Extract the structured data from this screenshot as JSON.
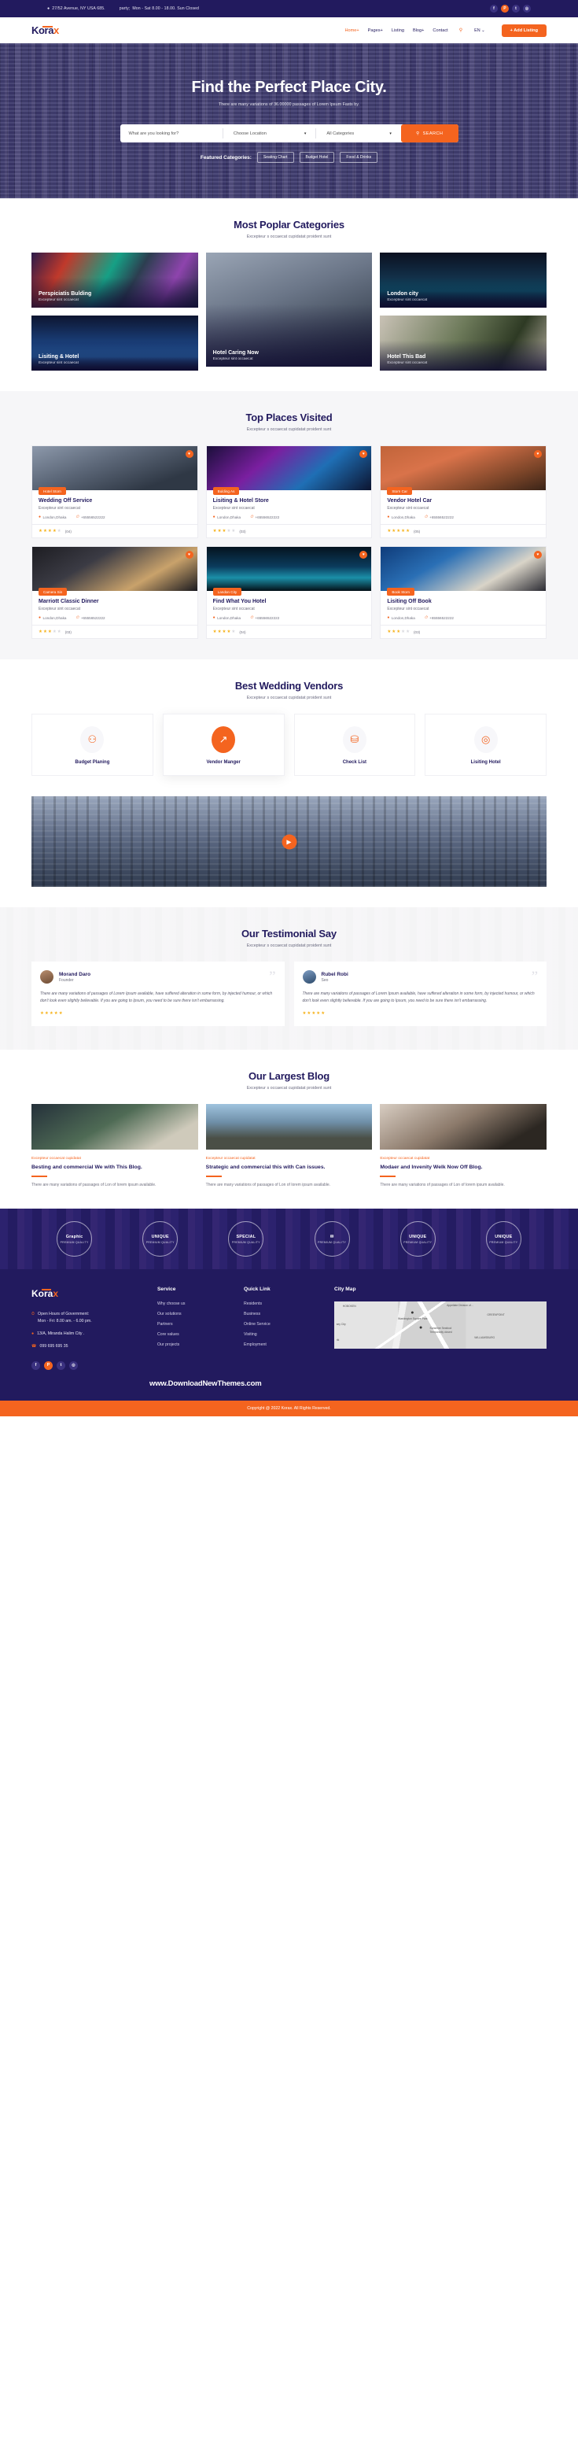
{
  "topbar": {
    "address": "27/52 Avenue, NY USA 685.",
    "hours": "Mon - Sat 8.00 - 18.00. Sun Closed",
    "pin_icon": "location-pin-icon",
    "clock_icon": "clock-icon",
    "socials": [
      {
        "name": "facebook-icon",
        "glyph": "f"
      },
      {
        "name": "pinterest-icon",
        "glyph": "P"
      },
      {
        "name": "twitter-icon",
        "glyph": "t"
      },
      {
        "name": "instagram-icon",
        "glyph": "◎"
      }
    ]
  },
  "nav": {
    "logo_main": "Kora",
    "logo_accent": "x",
    "links": [
      {
        "label": "Home+",
        "active": true
      },
      {
        "label": "Pages+",
        "active": false
      },
      {
        "label": "Listing",
        "active": false
      },
      {
        "label": "Blog+",
        "active": false
      },
      {
        "label": "Contact",
        "active": false
      }
    ],
    "search_icon": "search-icon",
    "lang": "EN ⌄",
    "cta": "+ Add Listing"
  },
  "hero": {
    "title": "Find the Perfect Place City.",
    "subtitle": "There are many variations of 36.00000 passages of Lorem Ipsum Fasts by.",
    "search": {
      "keyword_placeholder": "What are you looking for?",
      "location_value": "Choose Location",
      "category_value": "All Categories",
      "button": "SEARCH",
      "search_icon": "search-icon"
    },
    "featured_label": "Featured Categories:",
    "chips": [
      "Seating Chart",
      "Budget Hotel",
      "Food & Drinks"
    ]
  },
  "categories": {
    "title": "Most Poplar Categories",
    "subtitle": "Excepteur s occaecat cupidatat proident sunt",
    "items": [
      {
        "title": "Perspiciatis Bulding",
        "sub": "Excepteur sint occaecat",
        "img": "im-times"
      },
      {
        "title": "Hotel Caring Now",
        "sub": "Excepteur sint occaecat",
        "img": "im-city"
      },
      {
        "title": "London city",
        "sub": "Excepteur sint occaecat",
        "img": "im-london"
      },
      {
        "title": "Lisiting & Hotel",
        "sub": "Excepteur sint occaecat",
        "img": "im-bridge"
      },
      {
        "title": "Hotel This Bad",
        "sub": "Excepteur sint occaecat",
        "img": "im-plant"
      }
    ]
  },
  "places": {
    "title": "Top Places Visited",
    "subtitle": "Excepteur s occaecat cupidatat proident sunt",
    "items": [
      {
        "tag": "Hotel Storn",
        "title": "Wedding Off Service",
        "desc": "Excepteur sint occaecat",
        "location": "London,Dhaka",
        "phone": "+65556522222",
        "stars": 4,
        "count": "(04)",
        "img": "im-p1"
      },
      {
        "tag": "Bulding As",
        "title": "Lisiting & Hotel Store",
        "desc": "Excepteur sint occaecat",
        "location": "London,Dhaka",
        "phone": "+65556522222",
        "stars": 3,
        "count": "(03)",
        "img": "im-p2"
      },
      {
        "tag": "Storn Car",
        "title": "Vendor Hotel Car",
        "desc": "Excepteur sint occaecat",
        "location": "London,Dhaka",
        "phone": "+65556522222",
        "stars": 5,
        "count": "(05)",
        "img": "im-p3"
      },
      {
        "tag": "Camera Sin",
        "title": "Marriott Classic Dinner",
        "desc": "Excepteur sint occaecat",
        "location": "London,Dhaka",
        "phone": "+65556522222",
        "stars": 3,
        "count": "(03)",
        "img": "im-p4"
      },
      {
        "tag": "Landon City",
        "title": "Find What You Hotel",
        "desc": "Excepteur sint occaecat",
        "location": "London,Dhaka",
        "phone": "+65556522222",
        "stars": 4,
        "count": "(04)",
        "img": "im-p5"
      },
      {
        "tag": "Book Storn",
        "title": "Lisiting Off Book",
        "desc": "Excepteur sint occaecat",
        "location": "London,Dhaka",
        "phone": "+65556522222",
        "stars": 3,
        "count": "(03)",
        "img": "im-p6"
      }
    ]
  },
  "vendors": {
    "title": "Best Wedding Vendors",
    "subtitle": "Excepteur s occaecat cupidatat proident sunt",
    "items": [
      {
        "label": "Budget Planing",
        "icon": "person-planner-icon",
        "glyph": "⚇",
        "active": false
      },
      {
        "label": "Vendor Manger",
        "icon": "growth-chart-icon",
        "glyph": "↗",
        "active": true
      },
      {
        "label": "Check List",
        "icon": "money-coins-icon",
        "glyph": "⛁",
        "active": false
      },
      {
        "label": "Lisiting Hotel",
        "icon": "target-icon",
        "glyph": "◎",
        "active": false
      }
    ]
  },
  "video": {
    "play_icon": "play-icon",
    "glyph": "▶"
  },
  "testimonial": {
    "title": "Our Testimonial Say",
    "subtitle": "Excepteur s occaecat cupidatat proident sunt",
    "items": [
      {
        "name": "Morand Daro",
        "role": "Founder",
        "text": "There are many variations of passages of Lorem Ipsum available, have suffered alteration in some form, by injected humour, or which don't look even slightly believable. If you are going to Ipsum, you need to be sure there isn't embarrassing.",
        "stars": 5
      },
      {
        "name": "Rubel Robi",
        "role": "Seo",
        "text": "There are many variations of passages of Lorem Ipsum available, have suffered alteration in some form, by injected humour, or which don't look even slightly believable. If you are going to Ipsum, you need to be sure there isn't embarrassing.",
        "stars": 5
      }
    ]
  },
  "blog": {
    "title": "Our Largest Blog",
    "subtitle": "Excepteur s occaecat cupidatat proident sunt",
    "items": [
      {
        "cat": "Excepteur occaecat cupidatat",
        "title": "Besting and commercial We with This Blog.",
        "excerpt": "There are many variations of passages of Lon of lorem ipsum available.",
        "img": "im-b1"
      },
      {
        "cat": "Excepteur occaecat cupidatat",
        "title": "Strategic and commercial this with Can issues.",
        "excerpt": "There are many variations of passages of Lon of lorem ipsum available.",
        "img": "im-b2"
      },
      {
        "cat": "Excepteur occaecat cupidatat",
        "title": "Modaer and Invenity Welk Now Off Blog.",
        "excerpt": "There are many variations of passages of Lon of lorem ipsum available.",
        "img": "im-b3"
      }
    ]
  },
  "brands": [
    {
      "main": "Graphic",
      "sub": "PREMIUM QUALITY"
    },
    {
      "main": "UNIQUE",
      "sub": "PREMIUM QUALITY"
    },
    {
      "main": "SPECIAL",
      "sub": "PREMIUM QUALITY"
    },
    {
      "main": "✉",
      "sub": "PREMIUM QUALITY"
    },
    {
      "main": "UNIQUE",
      "sub": "PREMIUM QUALITY"
    },
    {
      "main": "UNIQUE",
      "sub": "PREMIUM QUALITY"
    }
  ],
  "footer": {
    "logo_main": "Kora",
    "logo_accent": "x",
    "hours_label": "Open Hours of Government:",
    "hours_value": "Mon - Fri: 8.00 am. - 6.00 pm.",
    "address": "13/A, Miranda Halim City .",
    "phone": "099 695 695 35",
    "socials": [
      {
        "name": "facebook-icon",
        "glyph": "f"
      },
      {
        "name": "pinterest-icon",
        "glyph": "P"
      },
      {
        "name": "twitter-icon",
        "glyph": "t"
      },
      {
        "name": "instagram-icon",
        "glyph": "◎"
      }
    ],
    "service": {
      "heading": "Service",
      "items": [
        "Why choose us",
        "Our solutions",
        "Partners",
        "Core values",
        "Our projects"
      ]
    },
    "quicklink": {
      "heading": "Quick Link",
      "items": [
        "Residents",
        "Business",
        "Online Service",
        "Visiting",
        "Employment"
      ]
    },
    "citymap": {
      "heading": "City Map",
      "labels": [
        "HOBOKEN",
        "Appellate Division of...",
        "GREENPOINT",
        "Washington Square Park",
        "Sunshine Seafood",
        "Temporarily closed",
        "sey City",
        "WILLIAMSBURG",
        "rlk"
      ]
    },
    "www": "www.DownloadNewThemes.com",
    "copyright": "Copyright @ 2022 Korax. All Rights Reserved."
  },
  "colors": {
    "brand_navy": "#221a5e",
    "brand_orange": "#f4641f",
    "star": "#f6b21b"
  }
}
